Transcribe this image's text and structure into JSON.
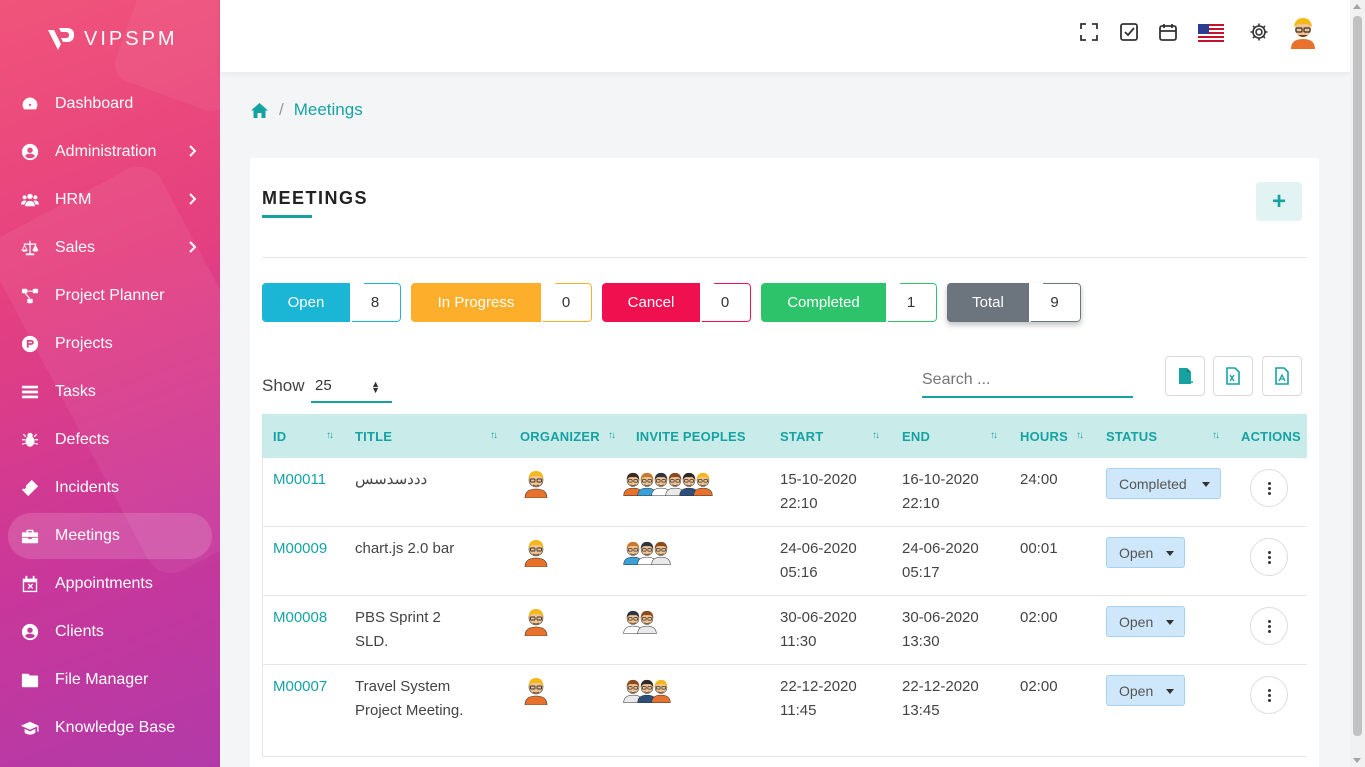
{
  "app": {
    "name": "VIPSPM"
  },
  "sidebar": {
    "items": [
      {
        "label": "Dashboard",
        "icon": "dashboard-icon",
        "chevron": false
      },
      {
        "label": "Administration",
        "icon": "user-circle-icon",
        "chevron": true
      },
      {
        "label": "HRM",
        "icon": "users-icon",
        "chevron": true
      },
      {
        "label": "Sales",
        "icon": "balance-scale-icon",
        "chevron": true
      },
      {
        "label": "Project Planner",
        "icon": "project-diagram-icon",
        "chevron": false
      },
      {
        "label": "Projects",
        "icon": "product-hunt-icon",
        "chevron": false
      },
      {
        "label": "Tasks",
        "icon": "tasks-list-icon",
        "chevron": false
      },
      {
        "label": "Defects",
        "icon": "bug-icon",
        "chevron": false
      },
      {
        "label": "Incidents",
        "icon": "ticket-icon",
        "chevron": false
      },
      {
        "label": "Meetings",
        "icon": "briefcase-icon",
        "chevron": false,
        "active": true
      },
      {
        "label": "Appointments",
        "icon": "calendar-times-icon",
        "chevron": false
      },
      {
        "label": "Clients",
        "icon": "user-circle-icon",
        "chevron": false
      },
      {
        "label": "File Manager",
        "icon": "folder-icon",
        "chevron": false
      },
      {
        "label": "Knowledge Base",
        "icon": "graduation-cap-icon",
        "chevron": false
      }
    ]
  },
  "breadcrumb": {
    "separator": "/",
    "current": "Meetings"
  },
  "page": {
    "title": "MEETINGS",
    "add_symbol": "+"
  },
  "stats": [
    {
      "label": "Open",
      "count": "8",
      "color": "#1bb5d6"
    },
    {
      "label": "In Progress",
      "count": "0",
      "color": "#fdaf2b"
    },
    {
      "label": "Cancel",
      "count": "0",
      "color": "#f0104f"
    },
    {
      "label": "Completed",
      "count": "1",
      "color": "#2dc36a"
    },
    {
      "label": "Total",
      "count": "9",
      "color": "#6c747d"
    }
  ],
  "controls": {
    "show_label": "Show",
    "page_size": "25",
    "search_placeholder": "Search ..."
  },
  "table": {
    "columns": [
      "ID",
      "TITLE",
      "ORGANIZER",
      "INVITE PEOPLES",
      "START",
      "END",
      "HOURS",
      "STATUS",
      "ACTIONS"
    ],
    "rows": [
      {
        "id": "M00011",
        "title": "دددسدسس",
        "start_date": "15-10-2020",
        "start_time": "22:10",
        "end_date": "16-10-2020",
        "end_time": "22:10",
        "hours": "24:00",
        "status": "Completed",
        "invitees": 6
      },
      {
        "id": "M00009",
        "title": "chart.js 2.0 bar",
        "start_date": "24-06-2020",
        "start_time": "05:16",
        "end_date": "24-06-2020",
        "end_time": "05:17",
        "hours": "00:01",
        "status": "Open",
        "invitees": 3
      },
      {
        "id": "M00008",
        "title": "PBS Sprint 2 SLD.",
        "start_date": "30-06-2020",
        "start_time": "11:30",
        "end_date": "30-06-2020",
        "end_time": "13:30",
        "hours": "02:00",
        "status": "Open",
        "invitees": 2
      },
      {
        "id": "M00007",
        "title": "Travel System Project Meeting.",
        "start_date": "22-12-2020",
        "start_time": "11:45",
        "end_date": "22-12-2020",
        "end_time": "13:45",
        "hours": "02:00",
        "status": "Open",
        "invitees": 3
      }
    ]
  },
  "theme": {
    "accent": "#17a2a2"
  }
}
